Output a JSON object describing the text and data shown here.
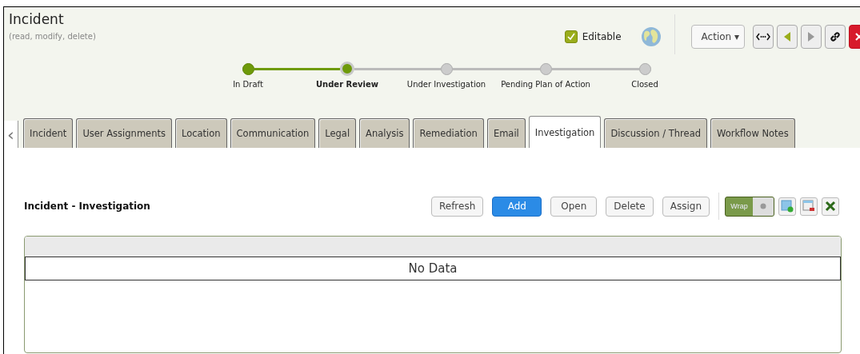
{
  "header": {
    "title": "Incident",
    "subtitle": "(read, modify, delete)",
    "editable": {
      "label": "Editable",
      "checked": true
    },
    "action_menu": "Action ▾"
  },
  "stages": [
    {
      "label": "In Draft",
      "completed": true,
      "selected": false
    },
    {
      "label": "Under Review",
      "completed": true,
      "selected": true
    },
    {
      "label": "Under Investigation",
      "completed": false,
      "selected": false
    },
    {
      "label": "Pending Plan of Action",
      "completed": false,
      "selected": false
    },
    {
      "label": "Closed",
      "completed": false,
      "selected": false
    }
  ],
  "scroll_left": "‹",
  "tabs": [
    {
      "label": "Incident",
      "selected": false
    },
    {
      "label": "User Assignments",
      "selected": false
    },
    {
      "label": "Location",
      "selected": false
    },
    {
      "label": "Communication",
      "selected": false
    },
    {
      "label": "Legal",
      "selected": false
    },
    {
      "label": "Analysis",
      "selected": false
    },
    {
      "label": "Remediation",
      "selected": false
    },
    {
      "label": "Email",
      "selected": false
    },
    {
      "label": "Investigation",
      "selected": true
    },
    {
      "label": "Discussion / Thread",
      "selected": false
    },
    {
      "label": "Workflow Notes",
      "selected": false
    }
  ],
  "section": {
    "title": "Incident - Investigation",
    "buttons": [
      {
        "label": "Refresh",
        "kind": "default"
      },
      {
        "label": "Add",
        "kind": "primary"
      },
      {
        "label": "Open",
        "kind": "default"
      },
      {
        "label": "Delete",
        "kind": "default"
      },
      {
        "label": "Assign",
        "kind": "default"
      }
    ],
    "wrap": {
      "label": "Wrap",
      "on": true
    }
  },
  "grid": {
    "empty_text": "No Data"
  }
}
